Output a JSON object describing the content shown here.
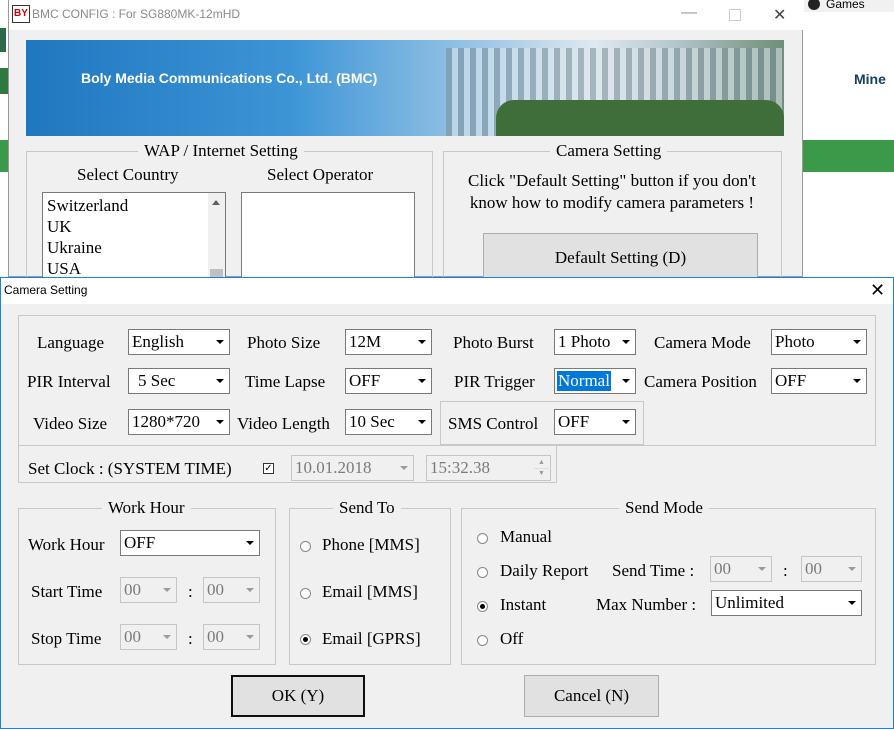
{
  "background": {
    "games_label": "Games",
    "mine_label": "Mine"
  },
  "bmc_window": {
    "title": "BMC CONFIG : For SG880MK-12mHD",
    "banner_text": "Boly Media Communications Co., Ltd. (BMC)",
    "wap_group": {
      "title": "WAP / Internet Setting",
      "select_country_label": "Select Country",
      "select_operator_label": "Select Operator",
      "countries": [
        "Switzerland",
        "UK",
        "Ukraine",
        "USA"
      ]
    },
    "camera_group": {
      "title": "Camera Setting",
      "hint": "Click \"Default Setting\" button if you don't know how to modify camera parameters !",
      "default_button": "Default Setting (D)"
    }
  },
  "dialog": {
    "title": "Camera Setting",
    "close_glyph": "✕",
    "row1": {
      "language_label": "Language",
      "language_value": "English",
      "photo_size_label": "Photo Size",
      "photo_size_value": "12M",
      "photo_burst_label": "Photo Burst",
      "photo_burst_value": "1 Photo",
      "camera_mode_label": "Camera Mode",
      "camera_mode_value": "Photo"
    },
    "row2": {
      "pir_interval_label": "PIR Interval",
      "pir_interval_value": "5 Sec",
      "time_lapse_label": "Time Lapse",
      "time_lapse_value": "OFF",
      "pir_trigger_label": "PIR Trigger",
      "pir_trigger_value": "Normal",
      "camera_position_label": "Camera Position",
      "camera_position_value": "OFF"
    },
    "row3": {
      "video_size_label": "Video Size",
      "video_size_value": "1280*720",
      "video_length_label": "Video Length",
      "video_length_value": "10 Sec",
      "sms_control_label": "SMS Control",
      "sms_control_value": "OFF"
    },
    "clock": {
      "label": "Set Clock : (SYSTEM TIME)",
      "checked": true,
      "date": "10.01.2018",
      "time": "15:32.38"
    },
    "work_hour": {
      "title": "Work Hour",
      "work_hour_label": "Work Hour",
      "work_hour_value": "OFF",
      "start_time_label": "Start Time",
      "start_h": "00",
      "start_m": "00",
      "stop_time_label": "Stop Time",
      "stop_h": "00",
      "stop_m": "00",
      "colon": ":"
    },
    "send_to": {
      "title": "Send To",
      "options": [
        "Phone [MMS]",
        "Email [MMS]",
        "Email [GPRS]"
      ],
      "selected": "Email [GPRS]"
    },
    "send_mode": {
      "title": "Send Mode",
      "options": [
        "Manual",
        "Daily Report",
        "Instant",
        "Off"
      ],
      "selected": "Instant",
      "send_time_label": "Send Time :",
      "send_h": "00",
      "send_m": "00",
      "colon": ":",
      "max_number_label": "Max Number :",
      "max_number_value": "Unlimited"
    },
    "ok_button": "OK (Y)",
    "cancel_button": "Cancel (N)"
  }
}
